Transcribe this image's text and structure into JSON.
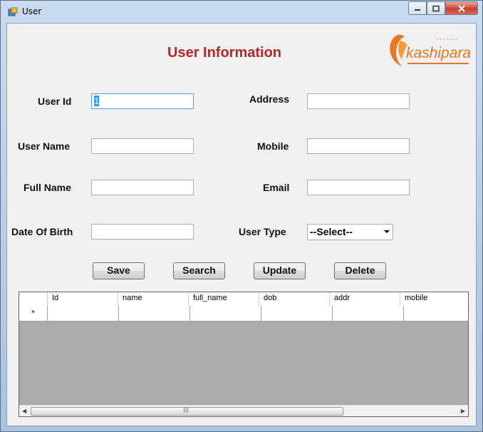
{
  "window": {
    "title": "User"
  },
  "form": {
    "heading": "User Information",
    "logo_text": "kashipara",
    "labels": {
      "user_id": "User Id",
      "user_name": "User Name",
      "full_name": "Full Name",
      "dob": "Date Of Birth",
      "address": "Address",
      "mobile": "Mobile",
      "email": "Email",
      "user_type": "User Type"
    },
    "values": {
      "user_id": "1",
      "user_name": "",
      "full_name": "",
      "dob": "",
      "address": "",
      "mobile": "",
      "email": "",
      "user_type": "--Select--"
    }
  },
  "buttons": {
    "save": "Save",
    "search": "Search",
    "update": "Update",
    "delete": "Delete"
  },
  "grid": {
    "columns": [
      "Id",
      "name",
      "full_name",
      "dob",
      "addr",
      "mobile"
    ],
    "new_row_marker": "*"
  },
  "colors": {
    "heading": "#b5282a",
    "logo": "#e87722",
    "grid_empty": "#ababab"
  }
}
